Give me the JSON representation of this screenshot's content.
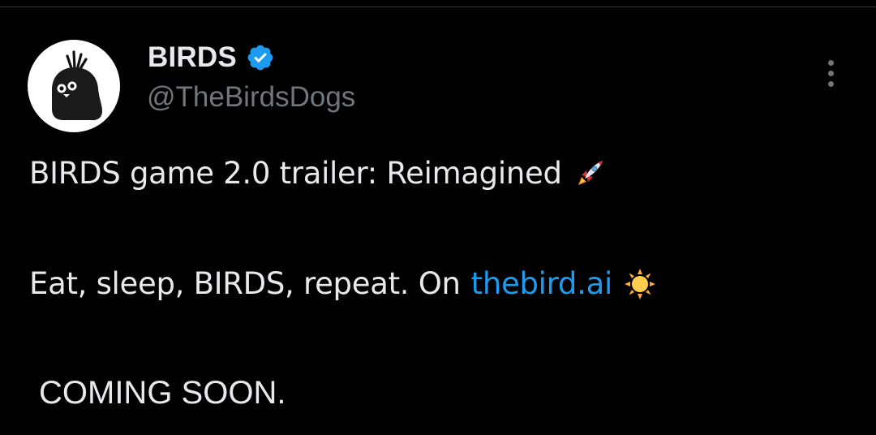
{
  "post": {
    "author": {
      "display_name": "BIRDS",
      "handle": "@TheBirdsDogs",
      "verified": true,
      "avatar_icon": "black-bird-icon"
    },
    "menu_icon": "more-options-icon",
    "lines": {
      "line1_text": "BIRDS game 2.0 trailer: Reimagined",
      "line1_emoji": "rocket-emoji",
      "line2_text": "Eat, sleep, BIRDS, repeat. On",
      "line2_link": "thebird.ai",
      "line2_emoji": "sun-emoji",
      "line3_text": "COMING SOON."
    }
  },
  "colors": {
    "background": "#000000",
    "text_primary": "#e7e9ea",
    "text_secondary": "#71767b",
    "link": "#1d9bf0",
    "verified_badge": "#1d9bf0"
  }
}
